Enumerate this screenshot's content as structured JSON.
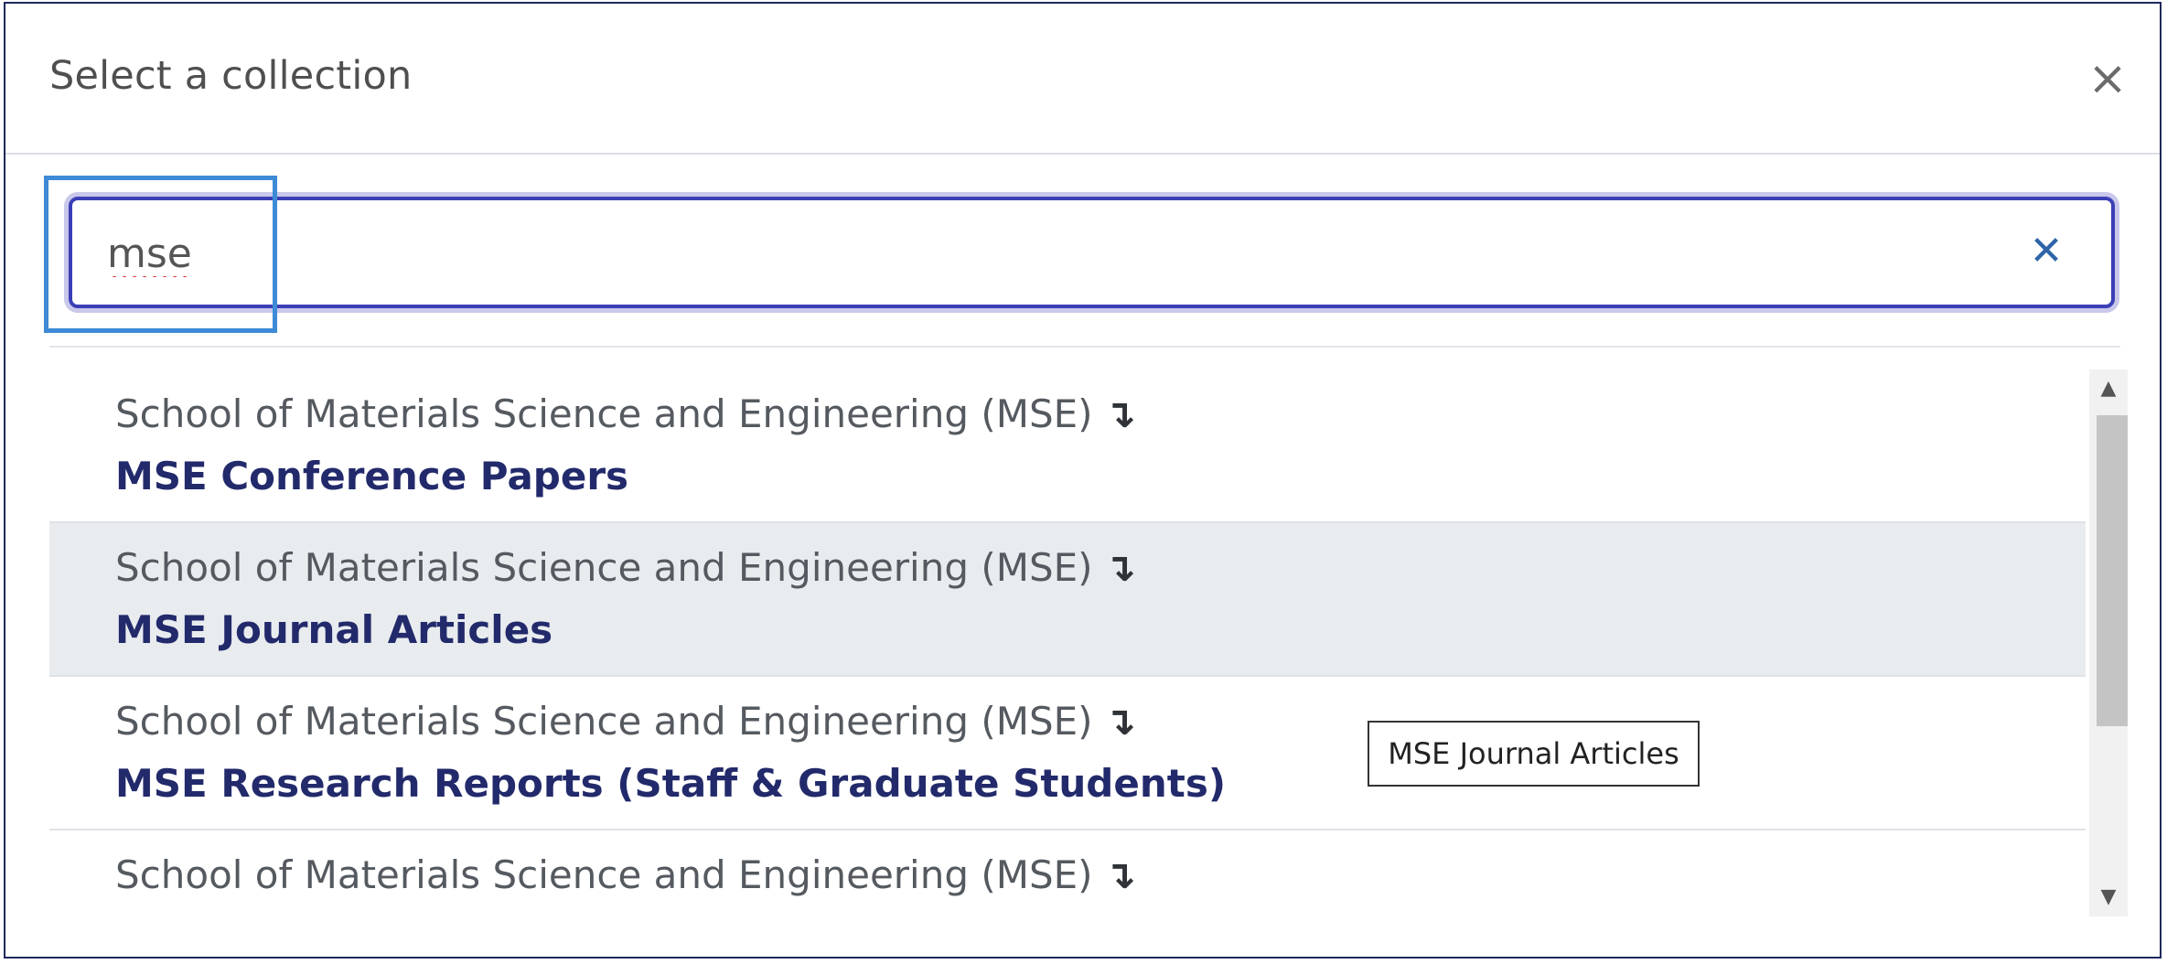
{
  "dialog": {
    "title": "Select a collection",
    "close_icon": "close-icon",
    "close_glyph": "×"
  },
  "search": {
    "value": "mse",
    "clear_icon": "clear-icon",
    "clear_glyph": "✕"
  },
  "results": [
    {
      "parent": "School of Materials Science and Engineering (MSE)",
      "arrow": "↴",
      "name": "MSE Conference Papers"
    },
    {
      "parent": "School of Materials Science and Engineering (MSE)",
      "arrow": "↴",
      "name": "MSE Journal Articles"
    },
    {
      "parent": "School of Materials Science and Engineering (MSE)",
      "arrow": "↴",
      "name": "MSE Research Reports (Staff & Graduate Students)"
    },
    {
      "parent": "School of Materials Science and Engineering (MSE)",
      "arrow": "↴",
      "name": ""
    }
  ],
  "tooltip": {
    "text": "MSE Journal Articles"
  },
  "scrollbar": {
    "up_glyph": "▲",
    "down_glyph": "▼",
    "scroll_position": 0.05
  },
  "colors": {
    "accent": "#3b3fb6",
    "focus_outline": "#3e8ad6",
    "link_text": "#222a6b",
    "hover_row": "#e9ecef",
    "clear_icon": "#2e64a8"
  }
}
